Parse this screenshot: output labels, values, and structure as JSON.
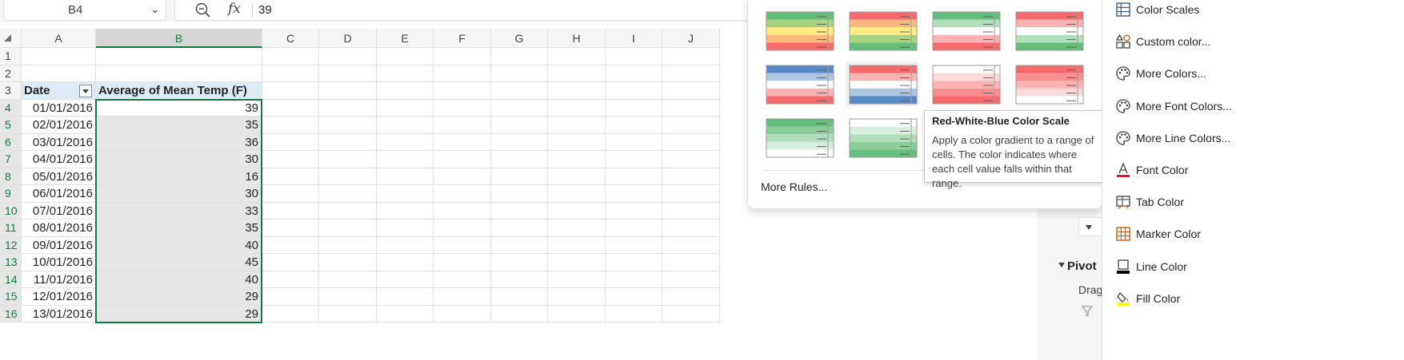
{
  "formula_bar": {
    "name_box": "B4",
    "fx_label": "fx",
    "value": "39"
  },
  "columns": [
    "A",
    "B",
    "C",
    "D",
    "E",
    "F",
    "G",
    "H",
    "I",
    "J"
  ],
  "rows": [
    "1",
    "2",
    "3",
    "4",
    "5",
    "6",
    "7",
    "8",
    "9",
    "10",
    "11",
    "12",
    "13",
    "14",
    "15",
    "16"
  ],
  "pivot_table": {
    "header_date": "Date",
    "header_value": "Average of Mean Temp (F)",
    "records": [
      {
        "date": "01/01/2016",
        "value": "39"
      },
      {
        "date": "02/01/2016",
        "value": "35"
      },
      {
        "date": "03/01/2016",
        "value": "36"
      },
      {
        "date": "04/01/2016",
        "value": "30"
      },
      {
        "date": "05/01/2016",
        "value": "16"
      },
      {
        "date": "06/01/2016",
        "value": "30"
      },
      {
        "date": "07/01/2016",
        "value": "33"
      },
      {
        "date": "08/01/2016",
        "value": "35"
      },
      {
        "date": "09/01/2016",
        "value": "40"
      },
      {
        "date": "10/01/2016",
        "value": "45"
      },
      {
        "date": "11/01/2016",
        "value": "40"
      },
      {
        "date": "12/01/2016",
        "value": "29"
      },
      {
        "date": "13/01/2016",
        "value": "29"
      }
    ]
  },
  "color_scales_menu": {
    "more_rules": "More Rules...",
    "scales": [
      {
        "colors": [
          "#63be7b",
          "#a9d27f",
          "#ffeb84",
          "#fcb77a",
          "#f8696b"
        ]
      },
      {
        "colors": [
          "#f8696b",
          "#fcb77a",
          "#ffeb84",
          "#a9d27f",
          "#63be7b"
        ]
      },
      {
        "colors": [
          "#63be7b",
          "#b1dfbc",
          "#ffffff",
          "#fbb2b3",
          "#f8696b"
        ]
      },
      {
        "colors": [
          "#f8696b",
          "#fbb2b3",
          "#ffffff",
          "#b1dfbc",
          "#63be7b"
        ]
      },
      {
        "colors": [
          "#5a8ac6",
          "#adc5e3",
          "#ffffff",
          "#fbb2b3",
          "#f8696b"
        ]
      },
      {
        "colors": [
          "#f8696b",
          "#fbb2b3",
          "#ffffff",
          "#adc5e3",
          "#5a8ac6"
        ]
      },
      {
        "colors": [
          "#ffffff",
          "#fcdadb",
          "#fbb2b3",
          "#f98e8f",
          "#f8696b"
        ]
      },
      {
        "colors": [
          "#f8696b",
          "#f98e8f",
          "#fbb2b3",
          "#fcdadb",
          "#ffffff"
        ]
      },
      {
        "colors": [
          "#63be7b",
          "#8acd9b",
          "#b1dfbc",
          "#d8efdd",
          "#ffffff"
        ]
      },
      {
        "colors": [
          "#ffffff",
          "#d8efdd",
          "#b1dfbc",
          "#8acd9b",
          "#63be7b"
        ]
      }
    ]
  },
  "tooltip": {
    "title": "Red-White-Blue Color Scale",
    "body": "Apply a color gradient to a range of cells. The color indicates where each cell value falls within that range."
  },
  "side_menu": {
    "items": [
      {
        "label": "Color Scales",
        "icon": "grid-icon"
      },
      {
        "label": "Custom color...",
        "icon": "shapes-icon"
      },
      {
        "label": "More Colors...",
        "icon": "palette-icon"
      },
      {
        "label": "More Font Colors...",
        "icon": "palette-icon"
      },
      {
        "label": "More Line Colors...",
        "icon": "palette-icon"
      },
      {
        "label": "Font Color",
        "icon": "font-color-icon",
        "accent": "#e81123"
      },
      {
        "label": "Tab Color",
        "icon": "tab-color-icon"
      },
      {
        "label": "Marker Color",
        "icon": "marker-grid-icon",
        "accent": "#c55a11"
      },
      {
        "label": "Line Color",
        "icon": "line-color-icon",
        "accent": "#000000"
      },
      {
        "label": "Fill Color",
        "icon": "fill-color-icon",
        "accent": "#ffff00"
      }
    ]
  },
  "pivot_pane": {
    "title": "Pivot",
    "drag_text": "Drag"
  },
  "colors": {
    "selection_green": "#107c41",
    "pivot_header_blue": "#ddebf7"
  }
}
